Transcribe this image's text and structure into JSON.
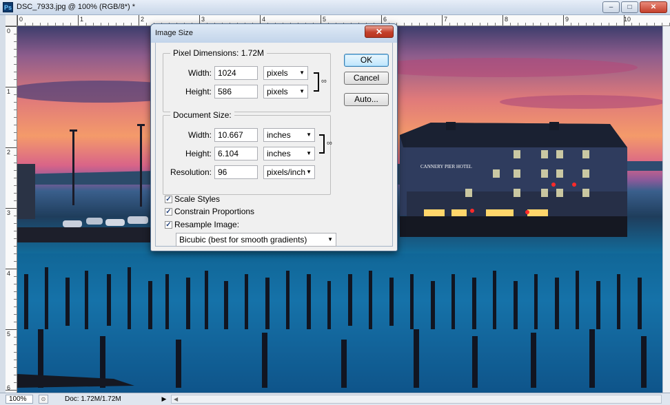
{
  "window": {
    "title": "DSC_7933.jpg @ 100% (RGB/8*) *",
    "app_icon": "Ps",
    "buttons": {
      "minimize": "–",
      "maximize": "□",
      "close": "✕"
    }
  },
  "ruler": {
    "top_labels": [
      "0",
      "1",
      "2",
      "3",
      "4",
      "5",
      "6",
      "7",
      "8",
      "9",
      "10"
    ],
    "left_labels": [
      "0",
      "1",
      "2",
      "3",
      "4",
      "5",
      "6"
    ]
  },
  "canvas": {
    "hotel_sign": "CANNERY PIER HOTEL"
  },
  "status": {
    "zoom": "100%",
    "doc": "Doc: 1.72M/1.72M",
    "menu_arrow": "▶",
    "scroll_left": "◀"
  },
  "dialog": {
    "title": "Image Size",
    "close_label": "✕",
    "pixel_dimensions": {
      "legend": "Pixel Dimensions:  1.72M",
      "width_label": "Width:",
      "width_value": "1024",
      "width_unit": "pixels",
      "height_label": "Height:",
      "height_value": "586",
      "height_unit": "pixels"
    },
    "document_size": {
      "legend": "Document Size:",
      "width_label": "Width:",
      "width_value": "10.667",
      "width_unit": "inches",
      "height_label": "Height:",
      "height_value": "6.104",
      "height_unit": "inches",
      "resolution_label": "Resolution:",
      "resolution_value": "96",
      "resolution_unit": "pixels/inch"
    },
    "buttons": {
      "ok": "OK",
      "cancel": "Cancel",
      "auto": "Auto..."
    },
    "checkboxes": {
      "scale_styles": {
        "label": "Scale Styles",
        "checked": true
      },
      "constrain": {
        "label": "Constrain Proportions",
        "checked": true
      },
      "resample": {
        "label": "Resample Image:",
        "checked": true
      }
    },
    "resample_method": "Bicubic (best for smooth gradients)",
    "check_mark": "✓",
    "dropdown_arrow": "▼"
  }
}
